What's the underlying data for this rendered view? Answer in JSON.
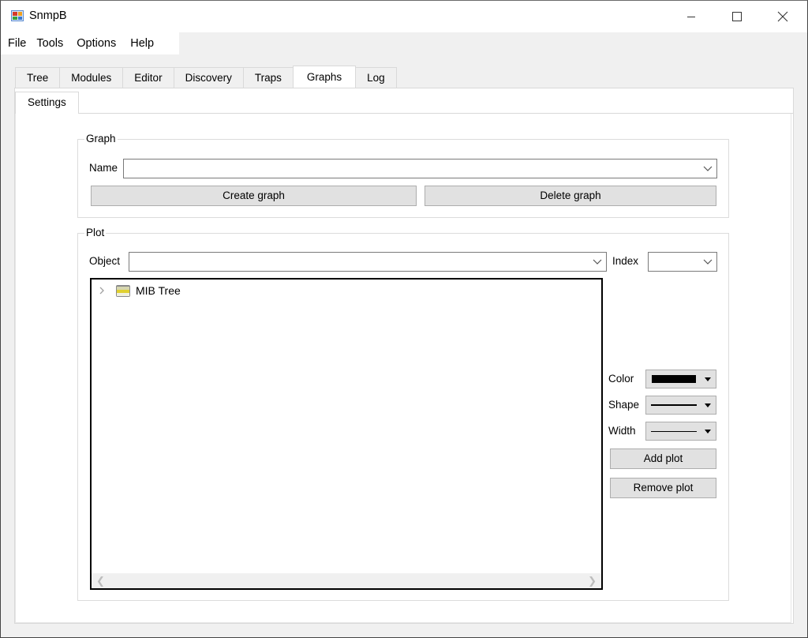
{
  "window": {
    "title": "SnmpB",
    "controls": {
      "minimize": "minimize",
      "maximize": "maximize",
      "close": "close"
    }
  },
  "menu": [
    "File",
    "Tools",
    "Options",
    "Help"
  ],
  "tabs": [
    {
      "label": "Tree",
      "active": false
    },
    {
      "label": "Modules",
      "active": false
    },
    {
      "label": "Editor",
      "active": false
    },
    {
      "label": "Discovery",
      "active": false
    },
    {
      "label": "Traps",
      "active": false
    },
    {
      "label": "Graphs",
      "active": true
    },
    {
      "label": "Log",
      "active": false
    }
  ],
  "subtabs": [
    {
      "label": "Settings",
      "active": true
    }
  ],
  "graph_group": {
    "title": "Graph",
    "name_label": "Name",
    "name_value": "",
    "create_button": "Create graph",
    "delete_button": "Delete graph"
  },
  "plot_group": {
    "title": "Plot",
    "object_label": "Object",
    "object_value": "",
    "index_label": "Index",
    "index_value": "",
    "tree": {
      "items": [
        {
          "label": "MIB Tree",
          "icon": "folder-icon",
          "expanded": false
        }
      ]
    },
    "color_label": "Color",
    "color_value": "#000000",
    "shape_label": "Shape",
    "shape_value": "solid-line",
    "width_label": "Width",
    "width_value": "thin-line",
    "add_button": "Add plot",
    "remove_button": "Remove plot"
  }
}
